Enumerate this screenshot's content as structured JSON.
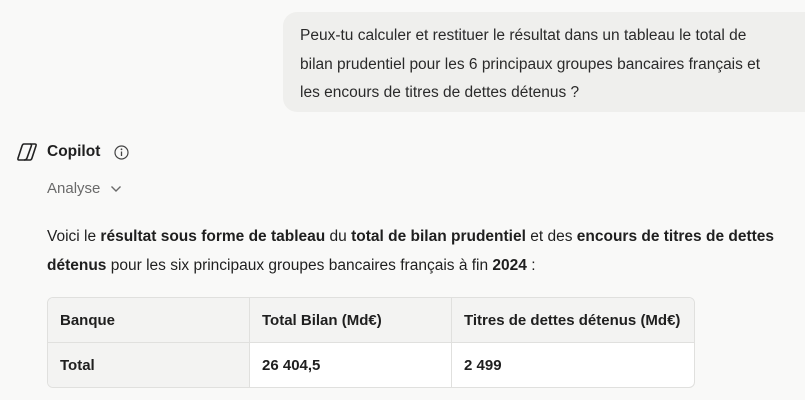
{
  "user_message": {
    "text": "Peux-tu calculer et restituer le résultat dans un tableau le total de bilan prudentiel  pour les 6 principaux groupes bancaires français et les encours de titres de dettes détenus ?"
  },
  "assistant": {
    "name": "Copilot",
    "logo_icon": "copilot-logo-icon",
    "info_icon": "info-icon",
    "analyse_label": "Analyse",
    "answer": {
      "p1": "Voici le ",
      "b1": "résultat sous forme de tableau",
      "p2": " du ",
      "b2": "total de bilan prudentiel",
      "p3": " et des ",
      "b3": "encours de titres de dettes détenus",
      "p4": " pour les six principaux groupes bancaires français à fin ",
      "b4": "2024",
      "p5": " :"
    }
  },
  "table": {
    "headers": [
      "Banque",
      "Total Bilan (Md€)",
      "Titres de dettes détenus (Md€)"
    ],
    "rows": [
      [
        "Total",
        "26 404,5",
        "2 499"
      ]
    ]
  },
  "colors": {
    "background": "#f9f9f8",
    "user_bubble": "#efefed",
    "table_header": "#f3f3f2",
    "border": "#e0e0de"
  }
}
